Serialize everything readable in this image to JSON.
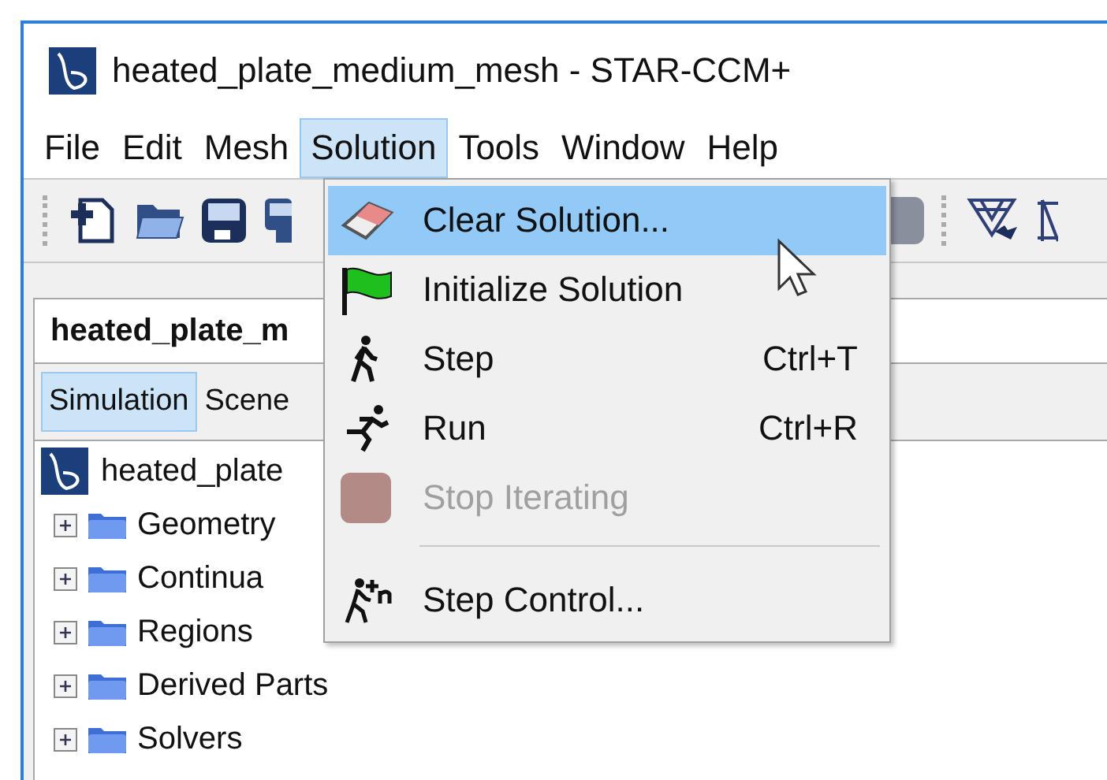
{
  "window": {
    "title": "heated_plate_medium_mesh - STAR-CCM+"
  },
  "menu_bar": [
    {
      "label": "File",
      "selected": false
    },
    {
      "label": "Edit",
      "selected": false
    },
    {
      "label": "Mesh",
      "selected": false
    },
    {
      "label": "Solution",
      "selected": true
    },
    {
      "label": "Tools",
      "selected": false
    },
    {
      "label": "Window",
      "selected": false
    },
    {
      "label": "Help",
      "selected": false
    }
  ],
  "solution_menu": [
    {
      "kind": "item",
      "label": "Clear Solution...",
      "selected": true,
      "disabled": false
    },
    {
      "kind": "item",
      "label": "Initialize Solution",
      "selected": false,
      "disabled": false
    },
    {
      "kind": "item",
      "label": "Step",
      "shortcut": "Ctrl+T",
      "selected": false,
      "disabled": false
    },
    {
      "kind": "item",
      "label": "Run",
      "shortcut": "Ctrl+R",
      "selected": false,
      "disabled": false
    },
    {
      "kind": "item",
      "label": "Stop Iterating",
      "selected": false,
      "disabled": true
    },
    {
      "kind": "separator"
    },
    {
      "kind": "item",
      "label": "Step Control...",
      "selected": false,
      "disabled": false
    }
  ],
  "panel": {
    "title": "heated_plate_m",
    "tabs": [
      {
        "label": "Simulation",
        "selected": true
      },
      {
        "label": "Scene",
        "selected": false
      }
    ],
    "tree": {
      "label": "heated_plate",
      "children": [
        {
          "label": "Geometry",
          "expanded": false
        },
        {
          "label": "Continua",
          "expanded": false
        },
        {
          "label": "Regions",
          "expanded": false
        },
        {
          "label": "Derived Parts",
          "expanded": false
        },
        {
          "label": "Solvers",
          "expanded": false
        }
      ]
    }
  }
}
